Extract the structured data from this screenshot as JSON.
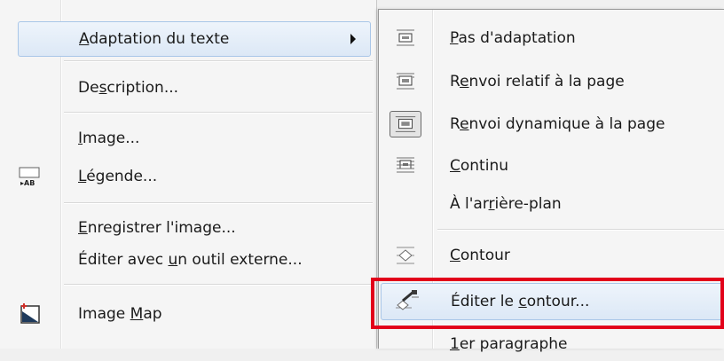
{
  "main_menu": {
    "items": [
      {
        "label": "Adaptation du texte",
        "mnemonic_index": 0
      },
      {
        "label": "Description...",
        "mnemonic_index": 2
      },
      {
        "label": "Image...",
        "mnemonic_index": 0
      },
      {
        "label": "Légende...",
        "mnemonic_index": 0,
        "icon": "caption-icon"
      },
      {
        "label": "Enregistrer l'image...",
        "mnemonic_index": 0
      },
      {
        "label": "Éditer avec un outil externe...",
        "mnemonic_index": 12
      },
      {
        "label": "Image Map",
        "mnemonic_index": 6,
        "icon": "image-map-icon"
      }
    ],
    "highlighted_index": 0
  },
  "sub_menu": {
    "items": [
      {
        "label": "Pas d'adaptation",
        "mnemonic_index": 0,
        "icon": "wrap-none-icon"
      },
      {
        "label": "Renvoi relatif à la page",
        "mnemonic_index": 1,
        "icon": "wrap-page-icon"
      },
      {
        "label": "Renvoi dynamique à la page",
        "mnemonic_index": 1,
        "icon": "wrap-dynamic-icon",
        "checked": true
      },
      {
        "label": "Continu",
        "mnemonic_index": 0,
        "icon": "wrap-through-icon"
      },
      {
        "label": "À l'arrière-plan",
        "mnemonic_index": 6
      },
      {
        "label": "Contour",
        "mnemonic_index": 0,
        "icon": "contour-icon"
      },
      {
        "label": "Éditer le contour...",
        "mnemonic_index": 10,
        "icon": "edit-contour-icon"
      },
      {
        "label": "1er paragraphe",
        "mnemonic_index": 0
      }
    ],
    "highlighted_index": 6
  },
  "colors": {
    "highlight_box": "#e2001a",
    "hover_border": "#a9c6e8"
  }
}
